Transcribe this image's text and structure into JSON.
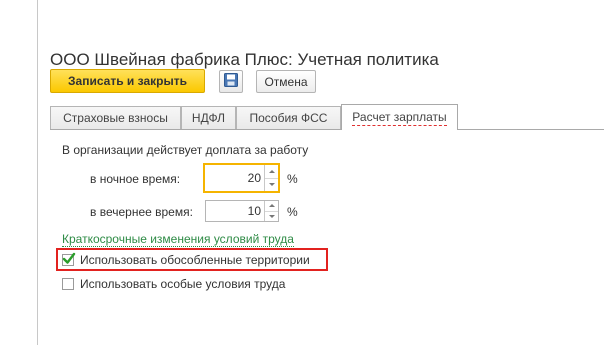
{
  "window": {
    "title": "ООО Швейная фабрика Плюс: Учетная политика"
  },
  "toolbar": {
    "save_close_label": "Записать и закрыть",
    "save_icon": "floppy-disk-icon",
    "cancel_label": "Отмена"
  },
  "tabs": [
    {
      "label": "Страховые взносы",
      "active": false
    },
    {
      "label": "НДФЛ",
      "active": false
    },
    {
      "label": "Пособия ФСС",
      "active": false
    },
    {
      "label": "Расчет зарплаты",
      "active": true
    }
  ],
  "content": {
    "surcharge_heading": "В организации действует доплата за работу",
    "night": {
      "label": "в ночное время:",
      "value": "20",
      "unit": "%"
    },
    "evening": {
      "label": "в вечернее время:",
      "value": "10",
      "unit": "%"
    },
    "section_link": "Краткосрочные изменения условий труда",
    "checkboxes": [
      {
        "label": "Использовать обособленные территории",
        "checked": true
      },
      {
        "label": "Использовать особые условия труда",
        "checked": false
      }
    ]
  },
  "colors": {
    "primary_button": "#fbc800",
    "focus_border": "#f5b400",
    "link_green": "#2e8b45",
    "highlight_red": "#e2221f",
    "check_green": "#2a9d2a"
  }
}
